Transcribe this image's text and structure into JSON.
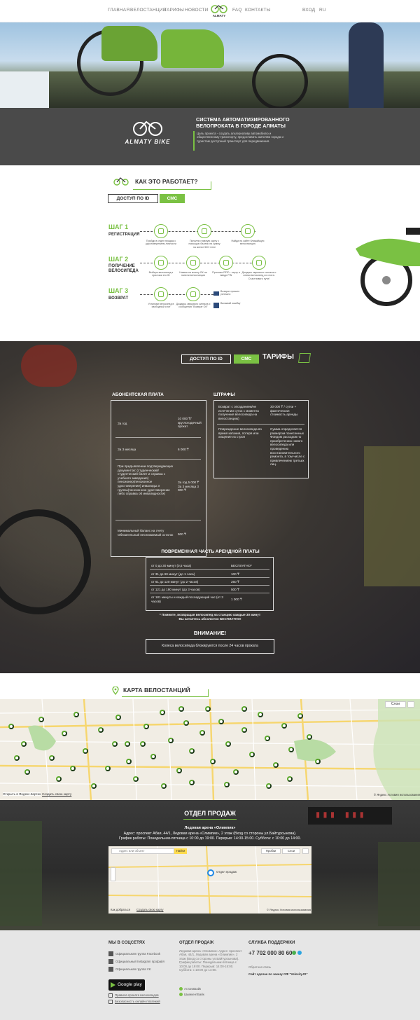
{
  "nav": {
    "items": [
      "ГЛАВНАЯ",
      "ВЕЛОСТАНЦИИ",
      "ТАРИФЫ",
      "НОВОСТИ",
      "FAQ",
      "КОНТАКТЫ"
    ],
    "login": "ВХОД",
    "lang": "RU"
  },
  "intro": {
    "logo_text": "ALMATY BIKE",
    "title": "СИСТЕМА АВТОМАТИЗИРОВАННОГО ВЕЛОПРОКАТА В ГОРОДЕ АЛМАТЫ",
    "text": "Цель проекта - создать альтернативу автомобилю и общественному транспорту, предоставить жителям города и туристам доступный транспорт для передвижения."
  },
  "how": {
    "title": "КАК ЭТО РАБОТАЕТ?",
    "btn_id": "ДОСТУП ПО ID",
    "btn_sms": "СМС",
    "steps": [
      {
        "num": "ШАГ 1",
        "label": "РЕГИСТРАЦИЯ",
        "captions": [
          "Пройди в отдел продаж с удостоверением личности",
          "Пополни главную карту с помощью баланс на сумму на менее 500 тенге",
          "Найди на сайте ближайшую велостанцию"
        ]
      },
      {
        "num": "ШАГ 2",
        "label": "ПОЛУЧЕНИЕ ВЕЛОСИПЕДА",
        "captions": [
          "Выбери велосипед и приложи его ID",
          "Нажми на кнопку ОК на панели велостанции",
          "Приложи RFID - карту и введи PIN",
          "Дождись звукового сигнала и сними велосипед со слота. Счастливого пути!"
        ]
      },
      {
        "num": "ШАГ 3",
        "label": "ВОЗВРАТ",
        "captions": [
          "Установи велосипед в свободный слот",
          "Дождись звукового сигнала и сообщения \"Возврат ОК\"",
          "Возврат прошел успешно",
          "Вызывай ошибку"
        ]
      }
    ]
  },
  "tariffs": {
    "btn_id": "ДОСТУП ПО ID",
    "btn_sms": "СМС",
    "title": "ТАРИФЫ",
    "sub_title": "АБОНЕНТСКАЯ ПЛАТА",
    "sub_rows": [
      {
        "k": "За год",
        "v": "10 000 ₸/ круглогодичный прокат"
      },
      {
        "k": "За 3 месяца",
        "v": "6 000 ₸"
      },
      {
        "k": "При предъявлении подтверждающих документов: (студенческий/студенческий билет и справка с учебного заведения) пенсионер(пенсионное удостоверение) инвалиды 3 группы(пенсионное удостоверение либо справка об инвалидности)",
        "v": "За год 5 000 ₸ За 3 месяца 3 000 ₸"
      },
      {
        "k": "Минимальный баланс на счету Обязательный неснижаемый остаток",
        "v": "500 ₸"
      }
    ],
    "fines_title": "ШТРАФЫ",
    "fines_rows": [
      {
        "k": "Возврат с опозданием/не истечении суток с момента получения велосипеда на велостанцию)",
        "v": "30 000 ₸ / сутки + фактическая стоимость аренды"
      },
      {
        "k": "Повреждение велосипеда во время катания, потеря или хищение из строя",
        "v": "Сумма определяется размером понесенных Фондом расходов по приобретению нового велосипеда или проведению восстановительного ремонта, в том числе с привлечением третьих лиц."
      }
    ],
    "rent_title": "ПОВРЕМЕННАЯ ЧАСТЬ АРЕНДНОЙ ПЛАТЫ",
    "rent_rows": [
      {
        "k": "от 0 до 30 минут (0,5 часа)",
        "v": "БЕСПЛАТНО*"
      },
      {
        "k": "от 31 до 60 минут (до 1 часа)",
        "v": "100 ₸"
      },
      {
        "k": "от 61 до 120 минут (до 2 часов)",
        "v": "250 ₸"
      },
      {
        "k": "от 121 до 180 минут (до 3 часов)",
        "v": "500 ₸"
      },
      {
        "k": "от 181 минуты и каждый последующий час (от 3 часов)",
        "v": "1 000 ₸"
      }
    ],
    "note_1": "* Помните, возвращая велосипед на станцию каждые 30 минут",
    "note_2": "Вы катаетесь абсолютно БЕСПЛАТНО!",
    "attention_title": "ВНИМАНИЕ!",
    "attention_text": "Колеса велосипеда блокируются после 24 часов проката"
  },
  "map": {
    "title": "КАРТА ВЕЛОСТАНЦИЙ",
    "layers": "Слои",
    "open_link": "Открыть в Яндекс.Картах",
    "create_link": "Создать свою карту",
    "copyright": "© Яндекс Условия использования"
  },
  "sales": {
    "title": "ОТДЕЛ ПРОДАЖ",
    "venue": "Ледовая арена «Олимпик»",
    "address": "Адрес: проспект Абая, 44/1, Ледовая арена «Олимпик», 2 этаж (Вход со стороны ул.Байтурсынова).",
    "hours": "График работы: Понедельник-пятница с 10:00 до 19:00. Перерыв: 14:00-15:00. Суббота: с 10:00 до 14:00.",
    "map_search": "Адрес или объект",
    "map_find": "Найти",
    "map_traffic": "Пробки",
    "map_layers": "Слои",
    "map_marker": "Отдел продаж",
    "map_open": "Как добраться",
    "map_create": "Создать свою карту",
    "map_copyright": "© Яндекс Условия использования"
  },
  "footer": {
    "social_title": "МЫ В СОЦСЕТЯХ",
    "social": [
      "Официальная группа Facebook",
      "Официальный Instagram профайл",
      "Официальная группа VK"
    ],
    "google_play": "Google play",
    "links": [
      "Правила проката велосипедов",
      "Безопасность онлайн платежей"
    ],
    "sales_title": "ОТДЕЛ ПРОДАЖ",
    "sales_text": "Ледовая арена «Олимпик» Адрес: проспект Абая, 44/1, Ледовая арена «Олимпик», 2 этаж (Вход со стороны ул.Байтурсынова). График работы: Понедельник-пятница с 10:00 до 19:00. Перерыв: 14:00-15:00. Суббота: с 10:00 до 14:00.",
    "partners": [
      "АстанаБайк",
      "ШымкентБайк"
    ],
    "support_title": "СЛУЖБА ПОДДЕРЖКИ",
    "phone": "+7 702 000 80 60",
    "feedback": "Обратная связь",
    "credit": "Сайт сделан по заказу ОФ \"VelocityJS\""
  },
  "colors": {
    "accent": "#7ac143",
    "dark": "#333333"
  }
}
